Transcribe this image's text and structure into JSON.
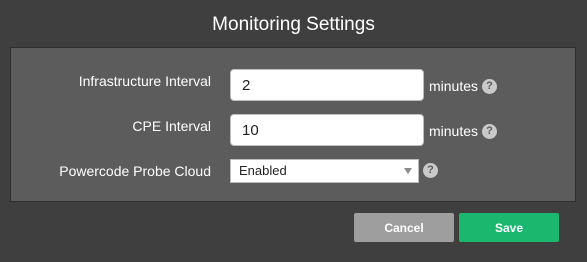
{
  "dialog": {
    "title": "Monitoring Settings"
  },
  "fields": {
    "infrastructure": {
      "label": "Infrastructure Interval",
      "value": "2",
      "unit": "minutes"
    },
    "cpe": {
      "label": "CPE Interval",
      "value": "10",
      "unit": "minutes"
    },
    "probe_cloud": {
      "label": "Powercode Probe Cloud",
      "selected": "Enabled"
    }
  },
  "help_glyph": "?",
  "buttons": {
    "cancel": "Cancel",
    "save": "Save"
  },
  "colors": {
    "save": "#1bb76e",
    "cancel": "#9e9e9e",
    "background": "#3f3f3f",
    "panel": "#5c5c5c"
  }
}
